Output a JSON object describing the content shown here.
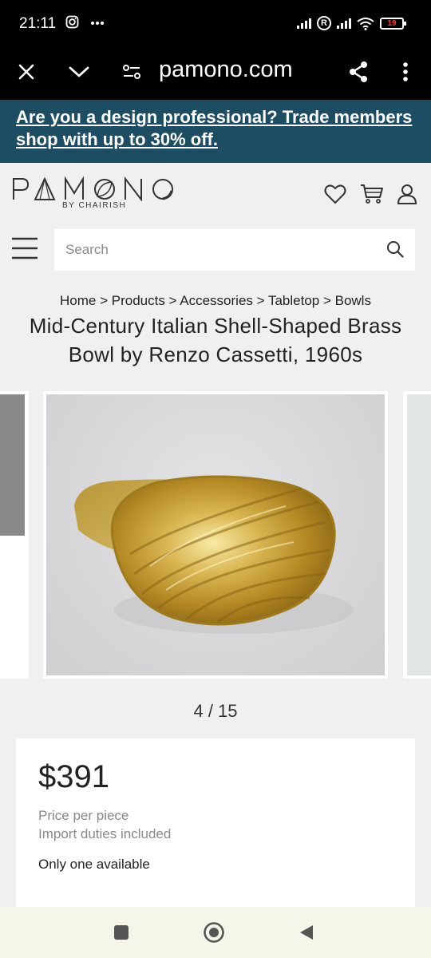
{
  "status_bar": {
    "time": "21:11",
    "left_icons": [
      "instagram-icon",
      "more-dots-icon"
    ],
    "right_icons": [
      "signal-icon",
      "roaming-r-icon",
      "signal-icon",
      "wifi-icon",
      "battery-icon"
    ],
    "roaming_label": "R",
    "battery_level": "19"
  },
  "browser": {
    "url": "pamono.com",
    "icons": [
      "close-icon",
      "chevron-down-icon",
      "site-settings-icon",
      "share-icon",
      "overflow-menu-icon"
    ]
  },
  "promo": {
    "text": "Are you a design professional? Trade members shop with up to 30% off.",
    "background": "#1c4d63"
  },
  "header": {
    "logo_text": "PAMONO",
    "logo_tagline": "BY CHAIRISH",
    "icons": [
      "heart-icon",
      "cart-icon",
      "user-icon"
    ]
  },
  "search": {
    "placeholder": "Search"
  },
  "breadcrumb": "Home > Products > Accessories > Tabletop > Bowls",
  "product": {
    "title": "Mid-Century Italian Shell-Shaped Brass Bowl by Renzo Cassetti, 1960s",
    "image_counter": "4 / 15",
    "price": "$391",
    "price_note": "Price per piece",
    "duties_note": "Import duties included",
    "availability": "Only one available"
  },
  "nav_bar": {
    "icons": [
      "recents-square-icon",
      "home-circle-icon",
      "back-triangle-icon"
    ]
  }
}
